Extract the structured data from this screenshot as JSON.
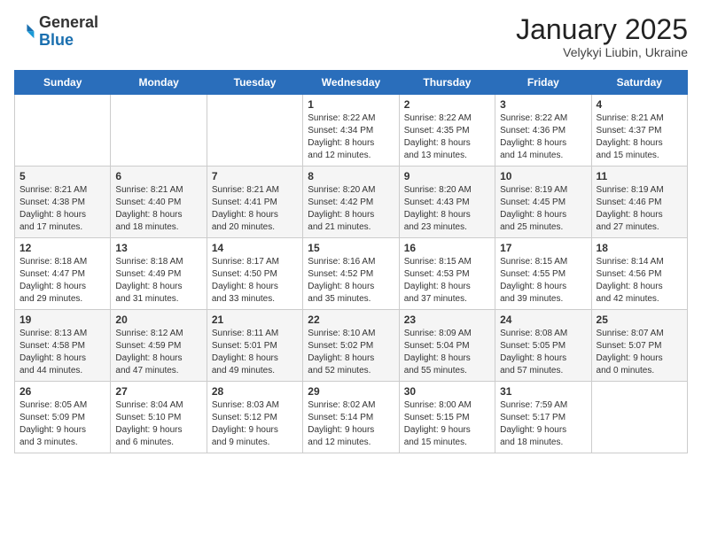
{
  "logo": {
    "general": "General",
    "blue": "Blue"
  },
  "header": {
    "month_year": "January 2025",
    "location": "Velykyi Liubin, Ukraine"
  },
  "days_of_week": [
    "Sunday",
    "Monday",
    "Tuesday",
    "Wednesday",
    "Thursday",
    "Friday",
    "Saturday"
  ],
  "weeks": [
    [
      {
        "day": "",
        "info": ""
      },
      {
        "day": "",
        "info": ""
      },
      {
        "day": "",
        "info": ""
      },
      {
        "day": "1",
        "info": "Sunrise: 8:22 AM\nSunset: 4:34 PM\nDaylight: 8 hours\nand 12 minutes."
      },
      {
        "day": "2",
        "info": "Sunrise: 8:22 AM\nSunset: 4:35 PM\nDaylight: 8 hours\nand 13 minutes."
      },
      {
        "day": "3",
        "info": "Sunrise: 8:22 AM\nSunset: 4:36 PM\nDaylight: 8 hours\nand 14 minutes."
      },
      {
        "day": "4",
        "info": "Sunrise: 8:21 AM\nSunset: 4:37 PM\nDaylight: 8 hours\nand 15 minutes."
      }
    ],
    [
      {
        "day": "5",
        "info": "Sunrise: 8:21 AM\nSunset: 4:38 PM\nDaylight: 8 hours\nand 17 minutes."
      },
      {
        "day": "6",
        "info": "Sunrise: 8:21 AM\nSunset: 4:40 PM\nDaylight: 8 hours\nand 18 minutes."
      },
      {
        "day": "7",
        "info": "Sunrise: 8:21 AM\nSunset: 4:41 PM\nDaylight: 8 hours\nand 20 minutes."
      },
      {
        "day": "8",
        "info": "Sunrise: 8:20 AM\nSunset: 4:42 PM\nDaylight: 8 hours\nand 21 minutes."
      },
      {
        "day": "9",
        "info": "Sunrise: 8:20 AM\nSunset: 4:43 PM\nDaylight: 8 hours\nand 23 minutes."
      },
      {
        "day": "10",
        "info": "Sunrise: 8:19 AM\nSunset: 4:45 PM\nDaylight: 8 hours\nand 25 minutes."
      },
      {
        "day": "11",
        "info": "Sunrise: 8:19 AM\nSunset: 4:46 PM\nDaylight: 8 hours\nand 27 minutes."
      }
    ],
    [
      {
        "day": "12",
        "info": "Sunrise: 8:18 AM\nSunset: 4:47 PM\nDaylight: 8 hours\nand 29 minutes."
      },
      {
        "day": "13",
        "info": "Sunrise: 8:18 AM\nSunset: 4:49 PM\nDaylight: 8 hours\nand 31 minutes."
      },
      {
        "day": "14",
        "info": "Sunrise: 8:17 AM\nSunset: 4:50 PM\nDaylight: 8 hours\nand 33 minutes."
      },
      {
        "day": "15",
        "info": "Sunrise: 8:16 AM\nSunset: 4:52 PM\nDaylight: 8 hours\nand 35 minutes."
      },
      {
        "day": "16",
        "info": "Sunrise: 8:15 AM\nSunset: 4:53 PM\nDaylight: 8 hours\nand 37 minutes."
      },
      {
        "day": "17",
        "info": "Sunrise: 8:15 AM\nSunset: 4:55 PM\nDaylight: 8 hours\nand 39 minutes."
      },
      {
        "day": "18",
        "info": "Sunrise: 8:14 AM\nSunset: 4:56 PM\nDaylight: 8 hours\nand 42 minutes."
      }
    ],
    [
      {
        "day": "19",
        "info": "Sunrise: 8:13 AM\nSunset: 4:58 PM\nDaylight: 8 hours\nand 44 minutes."
      },
      {
        "day": "20",
        "info": "Sunrise: 8:12 AM\nSunset: 4:59 PM\nDaylight: 8 hours\nand 47 minutes."
      },
      {
        "day": "21",
        "info": "Sunrise: 8:11 AM\nSunset: 5:01 PM\nDaylight: 8 hours\nand 49 minutes."
      },
      {
        "day": "22",
        "info": "Sunrise: 8:10 AM\nSunset: 5:02 PM\nDaylight: 8 hours\nand 52 minutes."
      },
      {
        "day": "23",
        "info": "Sunrise: 8:09 AM\nSunset: 5:04 PM\nDaylight: 8 hours\nand 55 minutes."
      },
      {
        "day": "24",
        "info": "Sunrise: 8:08 AM\nSunset: 5:05 PM\nDaylight: 8 hours\nand 57 minutes."
      },
      {
        "day": "25",
        "info": "Sunrise: 8:07 AM\nSunset: 5:07 PM\nDaylight: 9 hours\nand 0 minutes."
      }
    ],
    [
      {
        "day": "26",
        "info": "Sunrise: 8:05 AM\nSunset: 5:09 PM\nDaylight: 9 hours\nand 3 minutes."
      },
      {
        "day": "27",
        "info": "Sunrise: 8:04 AM\nSunset: 5:10 PM\nDaylight: 9 hours\nand 6 minutes."
      },
      {
        "day": "28",
        "info": "Sunrise: 8:03 AM\nSunset: 5:12 PM\nDaylight: 9 hours\nand 9 minutes."
      },
      {
        "day": "29",
        "info": "Sunrise: 8:02 AM\nSunset: 5:14 PM\nDaylight: 9 hours\nand 12 minutes."
      },
      {
        "day": "30",
        "info": "Sunrise: 8:00 AM\nSunset: 5:15 PM\nDaylight: 9 hours\nand 15 minutes."
      },
      {
        "day": "31",
        "info": "Sunrise: 7:59 AM\nSunset: 5:17 PM\nDaylight: 9 hours\nand 18 minutes."
      },
      {
        "day": "",
        "info": ""
      }
    ]
  ]
}
